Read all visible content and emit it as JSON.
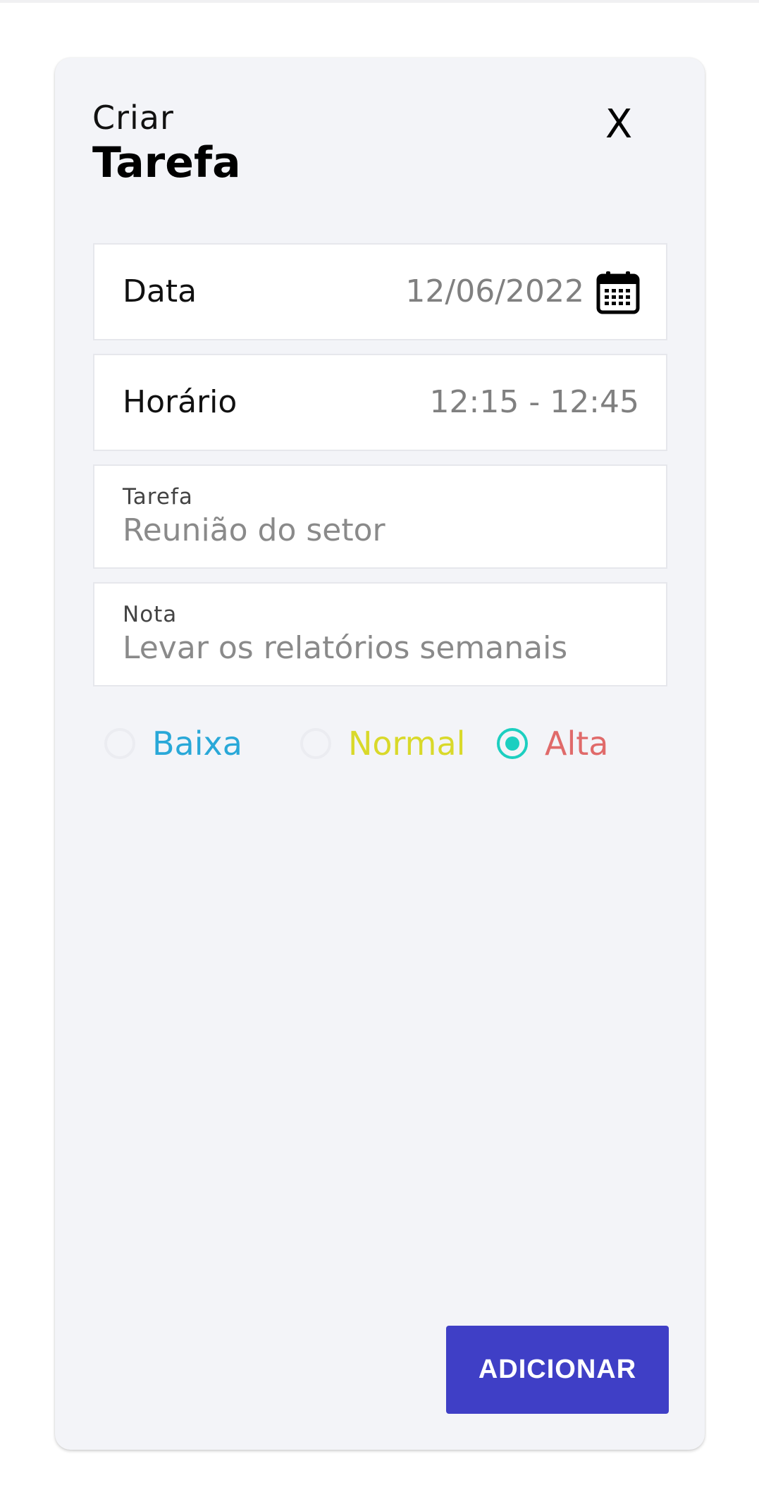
{
  "dialog": {
    "subtitle": "Criar",
    "title": "Tarefa",
    "close_label": "X"
  },
  "fields": {
    "date": {
      "label": "Data",
      "value": "12/06/2022",
      "icon": "calendar-icon"
    },
    "time": {
      "label": "Horário",
      "value": "12:15 - 12:45"
    },
    "task": {
      "label": "Tarefa",
      "value": "Reunião do setor"
    },
    "note": {
      "label": "Nota",
      "value": "Levar os relatórios semanais"
    }
  },
  "priority": {
    "selected": "Alta",
    "options": [
      {
        "label": "Baixa",
        "color": "#29a8d8",
        "checked": false
      },
      {
        "label": "Normal",
        "color": "#d9d92a",
        "checked": false
      },
      {
        "label": "Alta",
        "color": "#e06a6a",
        "checked": true
      }
    ],
    "checked_color": "#1ccfc0"
  },
  "actions": {
    "add_label": "ADICIONAR",
    "add_color": "#3f3fc6"
  }
}
